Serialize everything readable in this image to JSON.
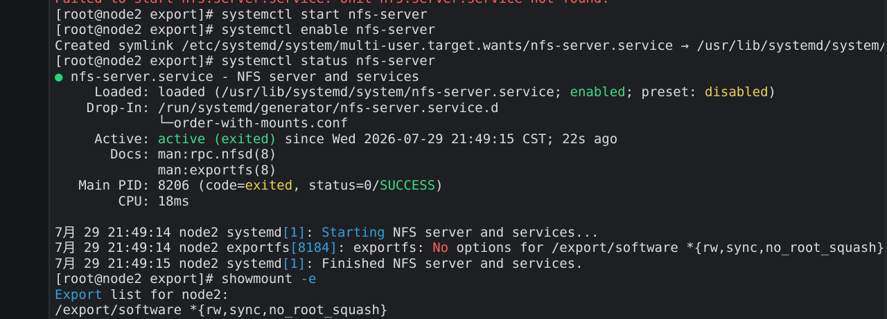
{
  "lines": [
    {
      "parts": [
        {
          "t": "Failed to start nfs.server.service: Unit nfs.server.service not found.",
          "c": "red"
        }
      ]
    },
    {
      "parts": [
        {
          "t": "[root@node2 export]# systemctl start nfs-server"
        }
      ]
    },
    {
      "parts": [
        {
          "t": "[root@node2 export]# systemctl enable nfs-server"
        }
      ]
    },
    {
      "parts": [
        {
          "t": "Created symlink /etc/systemd/system/multi-user.target.wants/nfs-server.service → /usr/lib/systemd/system/nfs-server.service."
        }
      ]
    },
    {
      "parts": [
        {
          "t": "[root@node2 export]# systemctl status nfs-server"
        }
      ]
    },
    {
      "parts": [
        {
          "t": "●",
          "c": "dot"
        },
        {
          "t": " nfs-server.service - NFS server and services"
        }
      ]
    },
    {
      "parts": [
        {
          "t": "     Loaded: loaded (/usr/lib/systemd/system/nfs-server.service; "
        },
        {
          "t": "enabled",
          "c": "green"
        },
        {
          "t": "; preset: "
        },
        {
          "t": "disabled",
          "c": "yellow"
        },
        {
          "t": ")"
        }
      ]
    },
    {
      "parts": [
        {
          "t": "    Drop-In: /run/systemd/generator/nfs-server.service.d"
        }
      ]
    },
    {
      "parts": [
        {
          "t": "             └─order-with-mounts.conf"
        }
      ]
    },
    {
      "parts": [
        {
          "t": "     Active: "
        },
        {
          "t": "active (exited)",
          "c": "green"
        },
        {
          "t": " since Wed 2026-07-29 21:49:15 CST; 22s ago"
        }
      ]
    },
    {
      "parts": [
        {
          "t": "       Docs: man:rpc.nfsd(8)"
        }
      ]
    },
    {
      "parts": [
        {
          "t": "             man:exportfs(8)"
        }
      ]
    },
    {
      "parts": [
        {
          "t": "   Main PID: 8206 (code="
        },
        {
          "t": "exited",
          "c": "yellow"
        },
        {
          "t": ", status=0/"
        },
        {
          "t": "SUCCESS",
          "c": "green"
        },
        {
          "t": ")"
        }
      ]
    },
    {
      "parts": [
        {
          "t": "        CPU: 18ms"
        }
      ]
    },
    {
      "parts": [
        {
          "t": ""
        }
      ]
    },
    {
      "parts": [
        {
          "t": "7月 29 21:49:14 node2 systemd"
        },
        {
          "t": "[1]",
          "c": "blue"
        },
        {
          "t": ": "
        },
        {
          "t": "Starting",
          "c": "blue"
        },
        {
          "t": " NFS server and services..."
        }
      ]
    },
    {
      "parts": [
        {
          "t": "7月 29 21:49:14 node2 exportfs"
        },
        {
          "t": "[8184]",
          "c": "blue"
        },
        {
          "t": ": exportfs: "
        },
        {
          "t": "No",
          "c": "red"
        },
        {
          "t": " options for /export/software *{rw,sync,no_root_squash}"
        }
      ]
    },
    {
      "parts": [
        {
          "t": "7月 29 21:49:15 node2 systemd"
        },
        {
          "t": "[1]",
          "c": "blue"
        },
        {
          "t": ": Finished NFS server and services."
        }
      ]
    },
    {
      "parts": [
        {
          "t": "[root@node2 export]# showmount "
        },
        {
          "t": "-e",
          "c": "blue"
        }
      ]
    },
    {
      "parts": [
        {
          "t": "Export",
          "c": "blue"
        },
        {
          "t": " list for node2:"
        }
      ]
    },
    {
      "parts": [
        {
          "t": "/export/software *{rw,sync,no_root_squash}"
        }
      ]
    }
  ]
}
